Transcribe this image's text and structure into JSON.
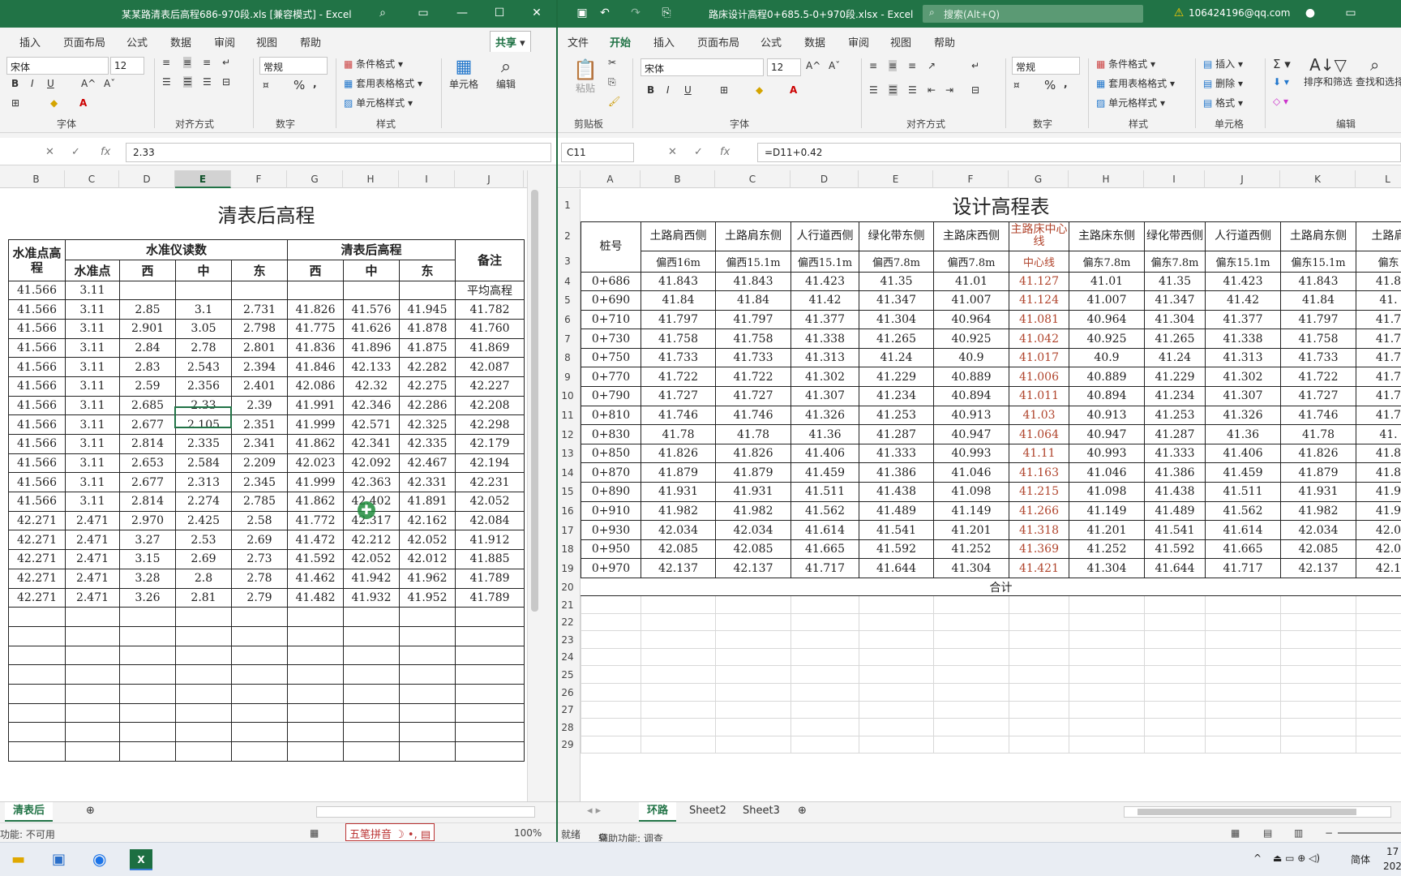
{
  "left": {
    "title": "某某路清表后高程686-970段.xls  [兼容模式]  -  Excel",
    "menu": [
      "插入",
      "页面布局",
      "公式",
      "数据",
      "审阅",
      "视图",
      "帮助"
    ],
    "share": "共享",
    "font_name": "宋体",
    "font_size": "12",
    "number_format": "常规",
    "styles": [
      "条件格式",
      "套用表格格式",
      "单元格样式"
    ],
    "cells_label": "单元格",
    "edit_label": "编辑",
    "groups": [
      "字体",
      "对齐方式",
      "数字",
      "样式"
    ],
    "formula": "2.33",
    "col_heads": [
      "B",
      "C",
      "D",
      "E",
      "F",
      "G",
      "H",
      "I",
      "J"
    ],
    "sheet_title": "清表后高程",
    "h_level_pt": "水准点高程",
    "h_reading": "水准仪读数",
    "h_after": "清表后高程",
    "h_note": "备注",
    "sub_heads": [
      "水准点",
      "西",
      "中",
      "东",
      "西",
      "中",
      "东"
    ],
    "rows": [
      [
        "41.566",
        "3.11",
        "",
        "",
        "",
        "",
        "",
        "",
        "平均高程"
      ],
      [
        "41.566",
        "3.11",
        "2.85",
        "3.1",
        "2.731",
        "41.826",
        "41.576",
        "41.945",
        "41.782"
      ],
      [
        "41.566",
        "3.11",
        "2.901",
        "3.05",
        "2.798",
        "41.775",
        "41.626",
        "41.878",
        "41.760"
      ],
      [
        "41.566",
        "3.11",
        "2.84",
        "2.78",
        "2.801",
        "41.836",
        "41.896",
        "41.875",
        "41.869"
      ],
      [
        "41.566",
        "3.11",
        "2.83",
        "2.543",
        "2.394",
        "41.846",
        "42.133",
        "42.282",
        "42.087"
      ],
      [
        "41.566",
        "3.11",
        "2.59",
        "2.356",
        "2.401",
        "42.086",
        "42.32",
        "42.275",
        "42.227"
      ],
      [
        "41.566",
        "3.11",
        "2.685",
        "2.33",
        "2.39",
        "41.991",
        "42.346",
        "42.286",
        "42.208"
      ],
      [
        "41.566",
        "3.11",
        "2.677",
        "2.105",
        "2.351",
        "41.999",
        "42.571",
        "42.325",
        "42.298"
      ],
      [
        "41.566",
        "3.11",
        "2.814",
        "2.335",
        "2.341",
        "41.862",
        "42.341",
        "42.335",
        "42.179"
      ],
      [
        "41.566",
        "3.11",
        "2.653",
        "2.584",
        "2.209",
        "42.023",
        "42.092",
        "42.467",
        "42.194"
      ],
      [
        "41.566",
        "3.11",
        "2.677",
        "2.313",
        "2.345",
        "41.999",
        "42.363",
        "42.331",
        "42.231"
      ],
      [
        "41.566",
        "3.11",
        "2.814",
        "2.274",
        "2.785",
        "41.862",
        "42.402",
        "41.891",
        "42.052"
      ],
      [
        "42.271",
        "2.471",
        "2.970",
        "2.425",
        "2.58",
        "41.772",
        "42.317",
        "42.162",
        "42.084"
      ],
      [
        "42.271",
        "2.471",
        "3.27",
        "2.53",
        "2.69",
        "41.472",
        "42.212",
        "42.052",
        "41.912"
      ],
      [
        "42.271",
        "2.471",
        "3.15",
        "2.69",
        "2.73",
        "41.592",
        "42.052",
        "42.012",
        "41.885"
      ],
      [
        "42.271",
        "2.471",
        "3.28",
        "2.8",
        "2.78",
        "41.462",
        "41.942",
        "41.962",
        "41.789"
      ],
      [
        "42.271",
        "2.471",
        "3.26",
        "2.81",
        "2.79",
        "41.482",
        "41.932",
        "41.952",
        "41.789"
      ]
    ],
    "sheet_tab": "清表后",
    "status": "功能: 不可用",
    "ime": "五笔拼音",
    "zoom": "100%"
  },
  "right": {
    "title": "路床设计高程0+685.5-0+970段.xlsx  -  Excel",
    "search": "搜索(Alt+Q)",
    "account": "106424196@qq.com",
    "menu": [
      "文件",
      "开始",
      "插入",
      "页面布局",
      "公式",
      "数据",
      "审阅",
      "视图",
      "帮助"
    ],
    "font_name": "宋体",
    "font_size": "12",
    "number_format": "常规",
    "styles": [
      "条件格式",
      "套用表格格式",
      "单元格样式"
    ],
    "cells": [
      "插入",
      "删除",
      "格式"
    ],
    "sort_filter": "排序和筛选",
    "find_select": "查找和选择",
    "groups": [
      "剪贴板",
      "字体",
      "对齐方式",
      "数字",
      "样式",
      "单元格",
      "编辑"
    ],
    "paste": "粘贴",
    "name_box": "C11",
    "formula": "=D11+0.42",
    "col_heads": [
      "A",
      "B",
      "C",
      "D",
      "E",
      "F",
      "G",
      "H",
      "I",
      "J",
      "K",
      "L"
    ],
    "sheet_title": "设计高程表",
    "head_row2": [
      "桩号",
      "土路肩西侧",
      "土路肩东侧",
      "人行道西侧",
      "绿化带东侧",
      "主路床西侧",
      "主路床中心线",
      "主路床东侧",
      "绿化带西侧",
      "人行道西侧",
      "土路肩东侧",
      "土路肩"
    ],
    "head_row3": [
      "偏西16m",
      "偏西15.1m",
      "偏西15.1m",
      "偏西7.8m",
      "偏西7.8m",
      "中心线",
      "偏东7.8m",
      "偏东7.8m",
      "偏东15.1m",
      "偏东15.1m",
      "偏东"
    ],
    "rows": [
      [
        "0+686",
        "41.843",
        "41.843",
        "41.423",
        "41.35",
        "41.01",
        "41.127",
        "41.01",
        "41.35",
        "41.423",
        "41.843",
        "41.8"
      ],
      [
        "0+690",
        "41.84",
        "41.84",
        "41.42",
        "41.347",
        "41.007",
        "41.124",
        "41.007",
        "41.347",
        "41.42",
        "41.84",
        "41."
      ],
      [
        "0+710",
        "41.797",
        "41.797",
        "41.377",
        "41.304",
        "40.964",
        "41.081",
        "40.964",
        "41.304",
        "41.377",
        "41.797",
        "41.7"
      ],
      [
        "0+730",
        "41.758",
        "41.758",
        "41.338",
        "41.265",
        "40.925",
        "41.042",
        "40.925",
        "41.265",
        "41.338",
        "41.758",
        "41.7"
      ],
      [
        "0+750",
        "41.733",
        "41.733",
        "41.313",
        "41.24",
        "40.9",
        "41.017",
        "40.9",
        "41.24",
        "41.313",
        "41.733",
        "41.7"
      ],
      [
        "0+770",
        "41.722",
        "41.722",
        "41.302",
        "41.229",
        "40.889",
        "41.006",
        "40.889",
        "41.229",
        "41.302",
        "41.722",
        "41.7"
      ],
      [
        "0+790",
        "41.727",
        "41.727",
        "41.307",
        "41.234",
        "40.894",
        "41.011",
        "40.894",
        "41.234",
        "41.307",
        "41.727",
        "41.7"
      ],
      [
        "0+810",
        "41.746",
        "41.746",
        "41.326",
        "41.253",
        "40.913",
        "41.03",
        "40.913",
        "41.253",
        "41.326",
        "41.746",
        "41.7"
      ],
      [
        "0+830",
        "41.78",
        "41.78",
        "41.36",
        "41.287",
        "40.947",
        "41.064",
        "40.947",
        "41.287",
        "41.36",
        "41.78",
        "41."
      ],
      [
        "0+850",
        "41.826",
        "41.826",
        "41.406",
        "41.333",
        "40.993",
        "41.11",
        "40.993",
        "41.333",
        "41.406",
        "41.826",
        "41.8"
      ],
      [
        "0+870",
        "41.879",
        "41.879",
        "41.459",
        "41.386",
        "41.046",
        "41.163",
        "41.046",
        "41.386",
        "41.459",
        "41.879",
        "41.8"
      ],
      [
        "0+890",
        "41.931",
        "41.931",
        "41.511",
        "41.438",
        "41.098",
        "41.215",
        "41.098",
        "41.438",
        "41.511",
        "41.931",
        "41.9"
      ],
      [
        "0+910",
        "41.982",
        "41.982",
        "41.562",
        "41.489",
        "41.149",
        "41.266",
        "41.149",
        "41.489",
        "41.562",
        "41.982",
        "41.9"
      ],
      [
        "0+930",
        "42.034",
        "42.034",
        "41.614",
        "41.541",
        "41.201",
        "41.318",
        "41.201",
        "41.541",
        "41.614",
        "42.034",
        "42.0"
      ],
      [
        "0+950",
        "42.085",
        "42.085",
        "41.665",
        "41.592",
        "41.252",
        "41.369",
        "41.252",
        "41.592",
        "41.665",
        "42.085",
        "42.0"
      ],
      [
        "0+970",
        "42.137",
        "42.137",
        "41.717",
        "41.644",
        "41.304",
        "41.421",
        "41.304",
        "41.644",
        "41.717",
        "42.137",
        "42.1"
      ]
    ],
    "total_label": "合计",
    "sheet_tabs": [
      "环路",
      "Sheet2",
      "Sheet3"
    ],
    "status_ready": "就绪",
    "status_access": "辅助功能: 调查"
  },
  "taskbar": {
    "lang": "简体",
    "time": "17",
    "date": "202"
  },
  "colors": {
    "excel_green": "#217346",
    "center_red": "#b0442c"
  }
}
